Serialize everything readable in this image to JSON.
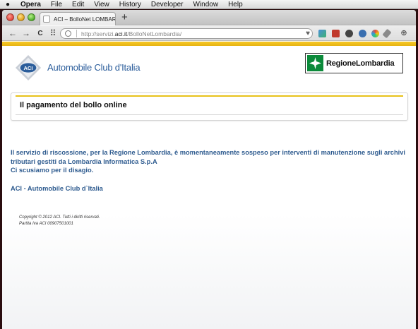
{
  "menubar": {
    "apple": "",
    "app": "Opera",
    "items": [
      "File",
      "Edit",
      "View",
      "History",
      "Developer",
      "Window",
      "Help"
    ]
  },
  "browser": {
    "tab_title": "ACI – BolloNet LOMBARDIA",
    "new_tab": "+",
    "nav": {
      "back": "←",
      "forward": "→",
      "reload": "C",
      "speed_dial": "⠿"
    },
    "address": {
      "scheme": "http://servizi.",
      "host": "aci.it",
      "path": "/BolloNetLombardia/"
    },
    "bookmark_icon": "heart-icon",
    "download": "⊕"
  },
  "header": {
    "aci_name": "Automobile Club d'Italia",
    "aci_logo_text": "ACI",
    "region_name": "RegioneLombardia"
  },
  "panel": {
    "title": "Il pagamento del bollo online"
  },
  "message": {
    "line1": "Il servizio di riscossione, per la Regione Lombardia, è momentaneamente sospeso per interventi di manutenzione sugli archivi",
    "line2": "tributari gestiti da Lombardia Informatica S.p.A",
    "line3": "Ci scusiamo per il disagio."
  },
  "footer": {
    "brand": "ACI - Automobile Club d`Italia",
    "copyright": "Copyright © 2012 ACI. Tutti i diritti riservati.",
    "vat": "Partita Iva ACI 00907501001"
  },
  "colors": {
    "accent_yellow": "#f6c828",
    "text_blue": "#2e5b8f",
    "lombardia_green": "#0b8a3a"
  }
}
